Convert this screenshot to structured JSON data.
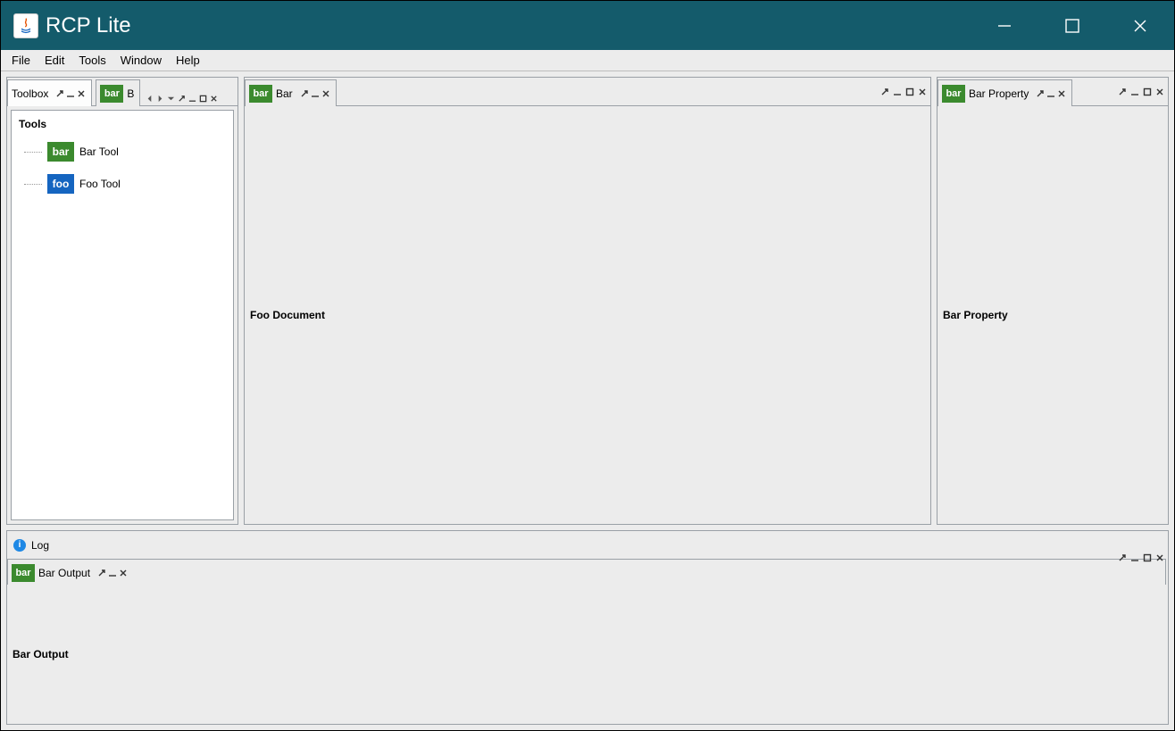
{
  "title": "RCP Lite",
  "menu": [
    "File",
    "Edit",
    "Tools",
    "Window",
    "Help"
  ],
  "toolbox": {
    "tab_label": "Toolbox",
    "b_tab_label": "B",
    "header": "Tools",
    "items": [
      {
        "badge": "bar",
        "badge_kind": "bar",
        "label": "Bar Tool"
      },
      {
        "badge": "foo",
        "badge_kind": "foo",
        "label": "Foo Tool"
      }
    ]
  },
  "editor": {
    "tab_badge": "bar",
    "tab_label": "Bar",
    "body_label": "Foo  Document"
  },
  "properties": {
    "tab_badge": "bar",
    "tab_label": "Bar Property",
    "body_label": "Bar Property"
  },
  "output": {
    "log_tab_label": "Log",
    "tab_badge": "bar",
    "tab_label": "Bar Output",
    "body_label": "Bar Output"
  }
}
